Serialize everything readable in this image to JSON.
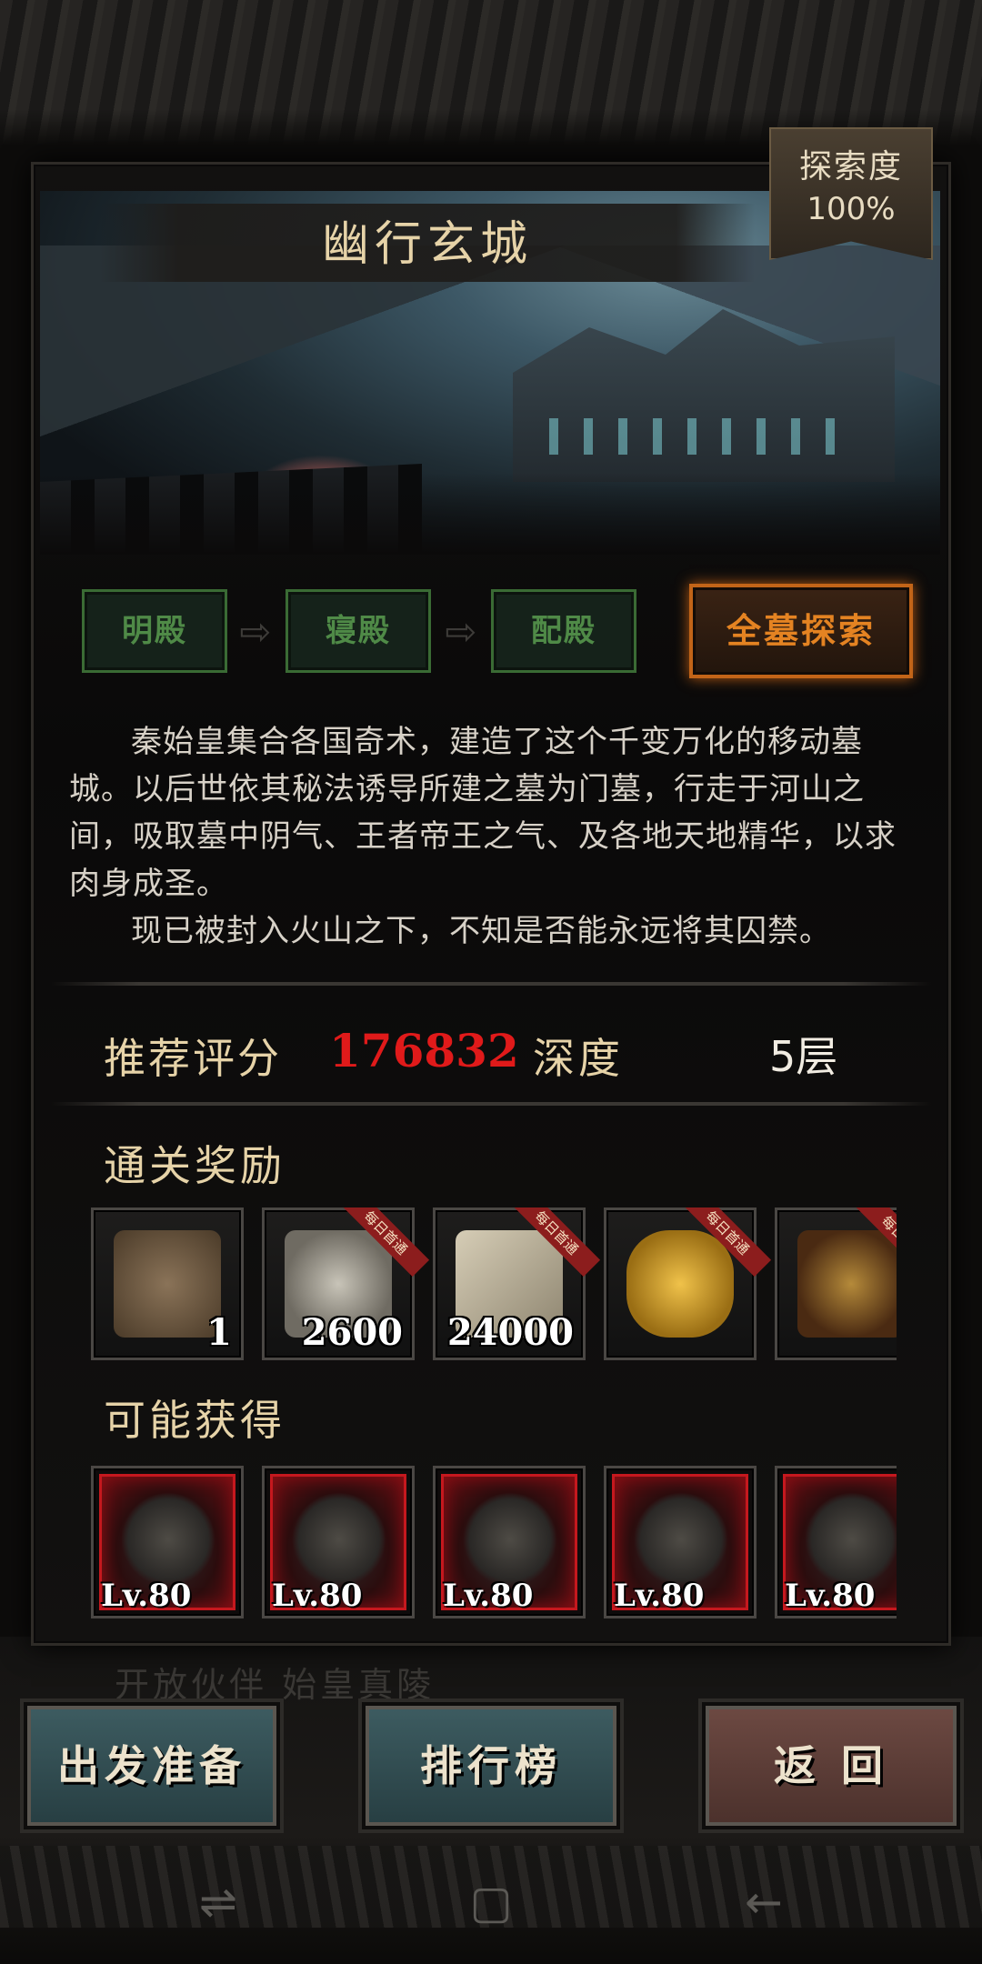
{
  "title": "幽行玄城",
  "exploration": {
    "label": "探索度",
    "value": "100%"
  },
  "stages": [
    "明殿",
    "寝殿",
    "配殿"
  ],
  "explore_all_label": "全墓探索",
  "description": [
    "秦始皇集合各国奇术，建造了这个千变万化的移动墓城。以后世依其秘法诱导所建之墓为门墓，行走于河山之间，吸取墓中阴气、王者帝王之气、及各地天地精华，以求肉身成圣。",
    "现已被封入火山之下，不知是否能永远将其囚禁。"
  ],
  "recommend": {
    "label": "推荐评分",
    "score": "176832"
  },
  "depth": {
    "label": "深度",
    "value": "5层"
  },
  "rewards": {
    "title": "通关奖励",
    "items": [
      {
        "icon": "token-icon",
        "qty": "1",
        "ribbon": "",
        "color": "#8a7358"
      },
      {
        "icon": "silver-pile-icon",
        "qty": "2600",
        "ribbon": "每日首通",
        "color": "#a7a397"
      },
      {
        "icon": "scroll-icon",
        "qty": "24000",
        "ribbon": "每日首通",
        "color": "#bdb4a0"
      },
      {
        "icon": "gold-nugget-icon",
        "qty": "",
        "ribbon": "每日首通",
        "color": "#c89a2a"
      },
      {
        "icon": "bow-icon",
        "qty": "",
        "ribbon": "每日首",
        "color": "#7a5a2a"
      }
    ]
  },
  "drops": {
    "title": "可能获得",
    "items": [
      {
        "icon": "amulet-icon",
        "level": "Lv.80"
      },
      {
        "icon": "bracelet-icon",
        "level": "Lv.80"
      },
      {
        "icon": "armor-icon",
        "level": "Lv.80"
      },
      {
        "icon": "robe-icon",
        "level": "Lv.80"
      },
      {
        "icon": "boots-icon",
        "level": "Lv.80"
      }
    ]
  },
  "background_text": "开放伙伴 始皇真陵",
  "buttons": {
    "prepare": "出发准备",
    "ranking": "排行榜",
    "back": "返 回"
  },
  "navbar": {
    "recent": "⇌",
    "home": "▢",
    "back": "←"
  }
}
